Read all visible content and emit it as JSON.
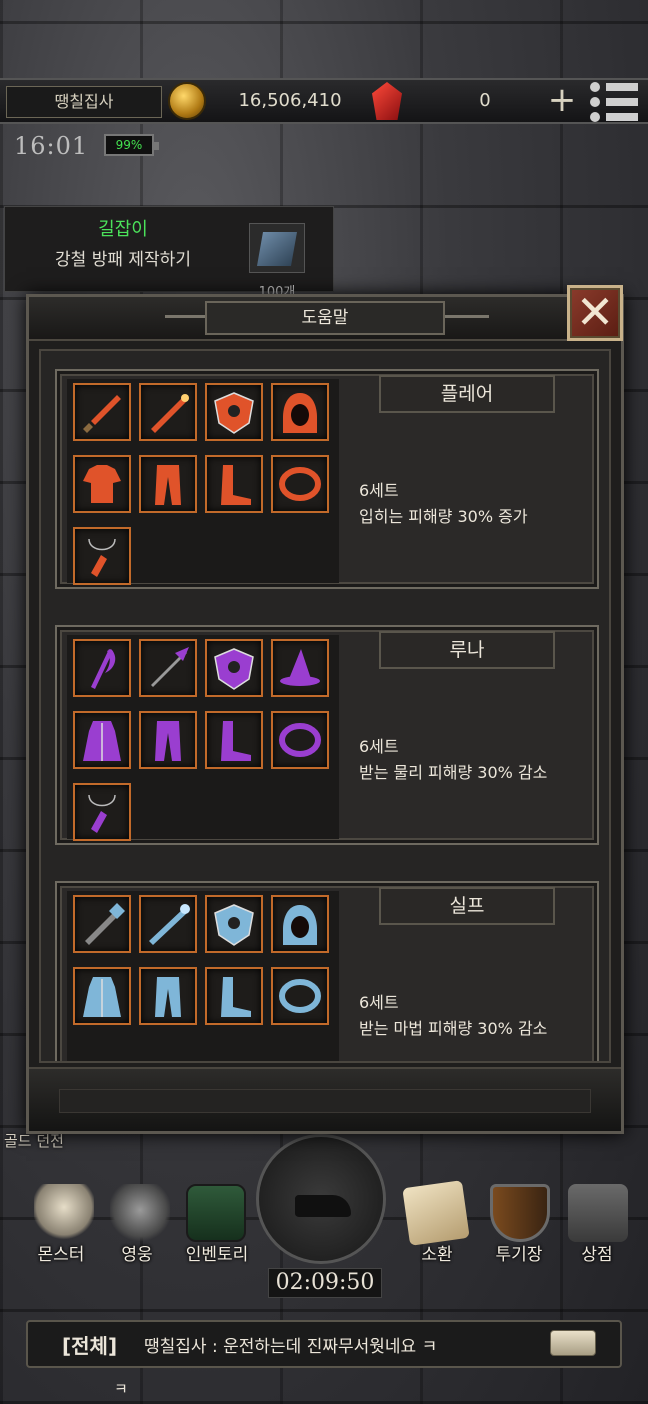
{
  "topbar": {
    "player_name": "땡칠집사",
    "gold": "16,506,410",
    "gems": "0"
  },
  "status": {
    "clock": "16:01",
    "battery": "99%"
  },
  "quest": {
    "guild": "길잡이",
    "task": "강철 방패 제작하기",
    "count": "100개"
  },
  "dialog": {
    "title": "도움말",
    "sets": [
      {
        "name": "플레어",
        "count": "6세트",
        "effect": "입히는 피해량 30% 증가",
        "color": "#e0532a",
        "items": [
          "sword-icon",
          "wand-icon",
          "shield-icon",
          "hood-icon",
          "armor-icon",
          "pants-icon",
          "boots-icon",
          "ring-icon",
          "amulet-icon"
        ]
      },
      {
        "name": "루나",
        "count": "6세트",
        "effect": "받는 물리 피해량 30% 감소",
        "color": "#9a3ed0",
        "items": [
          "scythe-icon",
          "spear-icon",
          "shield-icon",
          "hat-icon",
          "robe-icon",
          "pants-icon",
          "boots-icon",
          "ring-icon",
          "amulet-icon"
        ]
      },
      {
        "name": "실프",
        "count": "6세트",
        "effect": "받는 마법 피해량 30% 감소",
        "color": "#7fb6d8",
        "items": [
          "mace-icon",
          "staff-icon",
          "shield-icon",
          "hood-icon",
          "robe-icon",
          "pants-icon",
          "boots-icon",
          "ring-icon"
        ]
      }
    ]
  },
  "nav": {
    "monster": "몬스터",
    "hero": "영웅",
    "inventory": "인벤토리",
    "timer": "02:09:50",
    "summon": "소환",
    "arena": "투기장",
    "shop": "상점"
  },
  "chat": {
    "channel": "[전체]",
    "message": "땡칠집사 : 운전하는데 진짜무서웟네요 ㅋ",
    "wrap": "ㅋ"
  },
  "side_labels": {
    "gold_dungeon": "골드 던전"
  }
}
